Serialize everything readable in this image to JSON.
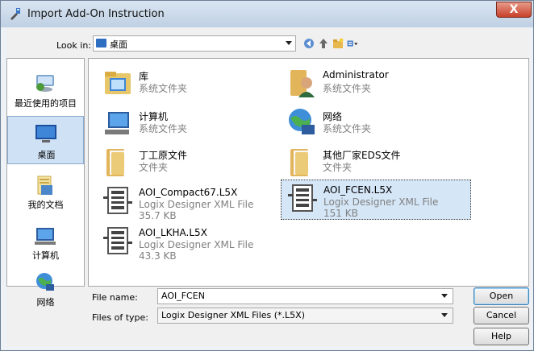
{
  "window": {
    "title": "Import Add-On Instruction",
    "close_label": "X"
  },
  "look_in": {
    "label": "Look in:",
    "value": "桌面"
  },
  "places": [
    {
      "label": "最近使用的项目",
      "icon": "recent-places-icon"
    },
    {
      "label": "桌面",
      "icon": "desktop-icon",
      "selected": true
    },
    {
      "label": "我的文档",
      "icon": "documents-icon"
    },
    {
      "label": "计算机",
      "icon": "computer-icon"
    },
    {
      "label": "网络",
      "icon": "network-icon"
    }
  ],
  "files": [
    {
      "name": "库",
      "type": "系统文件夹",
      "icon": "library-icon"
    },
    {
      "name": "Administrator",
      "type": "系统文件夹",
      "icon": "user-folder-icon"
    },
    {
      "name": "计算机",
      "type": "系统文件夹",
      "icon": "computer-icon"
    },
    {
      "name": "网络",
      "type": "系统文件夹",
      "icon": "network-icon"
    },
    {
      "name": "丁工原文件",
      "type": "文件夹",
      "icon": "folder-icon"
    },
    {
      "name": "其他厂家EDS文件",
      "type": "文件夹",
      "icon": "folder-icon"
    },
    {
      "name": "AOI_Compact67.L5X",
      "type": "Logix Designer XML File",
      "size": "35.7 KB",
      "icon": "l5x-file-icon"
    },
    {
      "name": "AOI_FCEN.L5X",
      "type": "Logix Designer XML File",
      "size": "151 KB",
      "icon": "l5x-file-icon",
      "selected": true
    },
    {
      "name": "AOI_LKHA.L5X",
      "type": "Logix Designer XML File",
      "size": "43.3 KB",
      "icon": "l5x-file-icon"
    }
  ],
  "file_name": {
    "label": "File name:",
    "value": "AOI_FCEN"
  },
  "files_of_type": {
    "label": "Files of type:",
    "value": "Logix Designer XML Files (*.L5X)"
  },
  "buttons": {
    "open": "Open",
    "cancel": "Cancel",
    "help": "Help"
  },
  "colors": {
    "selection": "#d5e6f7",
    "secondary_text": "#808080",
    "close_button": "#c7412b"
  }
}
